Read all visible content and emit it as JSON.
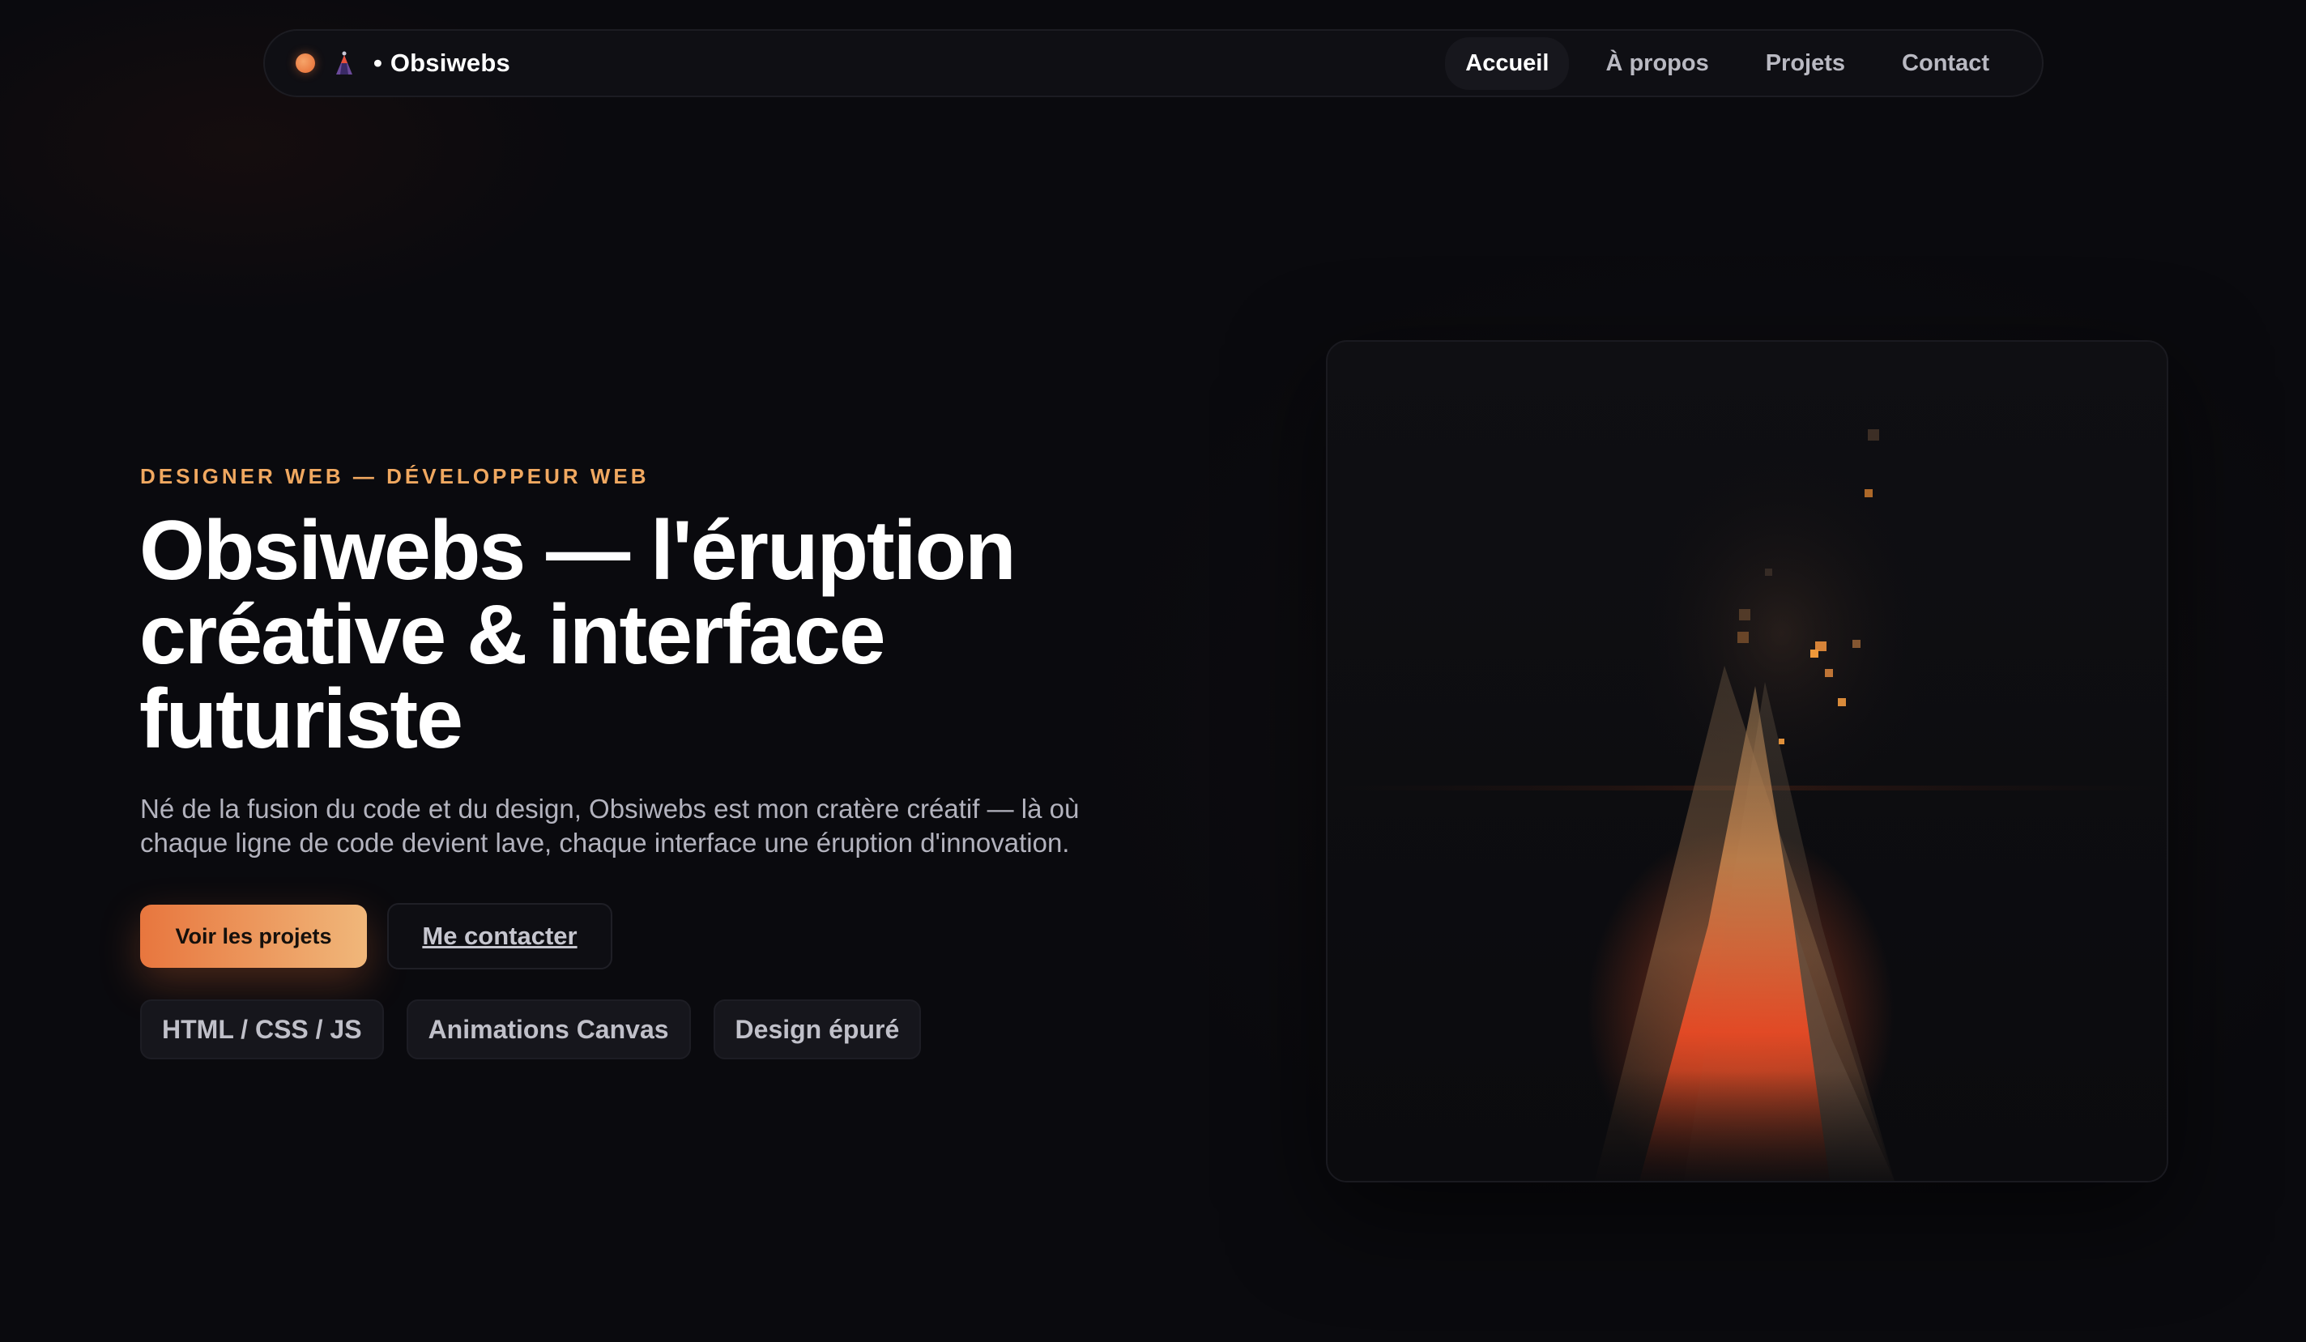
{
  "nav": {
    "brand_separator": "•",
    "brand_name": "Obsiwebs",
    "links": [
      {
        "label": "Accueil",
        "active": true
      },
      {
        "label": "À propos",
        "active": false
      },
      {
        "label": "Projets",
        "active": false
      },
      {
        "label": "Contact",
        "active": false
      }
    ]
  },
  "hero": {
    "eyebrow": "DESIGNER WEB — DÉVELOPPEUR WEB",
    "title_line1": "Obsiwebs — l'éruption",
    "title_line2": "créative & interface",
    "title_line3": "futuriste",
    "description_line1": "Né de la fusion du code et du design, Obsiwebs est mon cratère créatif — là où",
    "description_line2": "chaque ligne de code devient lave, chaque interface une éruption d'innovation.",
    "primary_cta": "Voir les projets",
    "secondary_cta": "Me contacter",
    "tags": [
      "HTML / CSS / JS",
      "Animations Canvas",
      "Design épuré"
    ]
  },
  "icons": {
    "status_dot": "orange-dot-icon",
    "brand": "volcano-icon"
  },
  "colors": {
    "background": "#0a0a0e",
    "accent": "#f0a860",
    "accent_start": "#e8763e",
    "accent_end": "#f0b77a",
    "lava": "#e8452a"
  }
}
